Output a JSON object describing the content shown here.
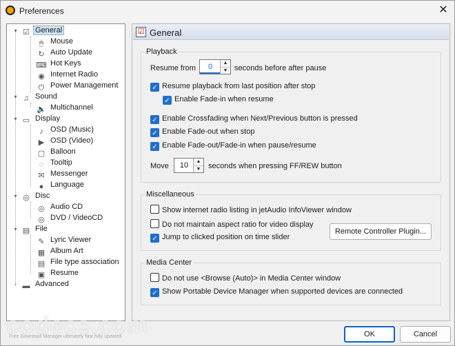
{
  "window": {
    "title": "Preferences"
  },
  "tree": {
    "items": [
      {
        "label": "General",
        "icon": "general-icon"
      },
      {
        "label": "Mouse",
        "icon": "mouse-icon"
      },
      {
        "label": "Auto Update",
        "icon": "update-icon"
      },
      {
        "label": "Hot Keys",
        "icon": "keyboard-icon"
      },
      {
        "label": "Internet Radio",
        "icon": "radio-icon"
      },
      {
        "label": "Power Management",
        "icon": "power-icon"
      },
      {
        "label": "Sound",
        "icon": "sound-icon"
      },
      {
        "label": "Multichannel",
        "icon": "speaker-icon"
      },
      {
        "label": "Display",
        "icon": "display-icon"
      },
      {
        "label": "OSD (Music)",
        "icon": "osd-music-icon"
      },
      {
        "label": "OSD (Video)",
        "icon": "osd-video-icon"
      },
      {
        "label": "Balloon",
        "icon": "balloon-icon"
      },
      {
        "label": "Tooltip",
        "icon": "tooltip-icon"
      },
      {
        "label": "Messenger",
        "icon": "messenger-icon"
      },
      {
        "label": "Language",
        "icon": "language-icon"
      },
      {
        "label": "Disc",
        "icon": "disc-icon"
      },
      {
        "label": "Audio CD",
        "icon": "cd-icon"
      },
      {
        "label": "DVD / VideoCD",
        "icon": "dvd-icon"
      },
      {
        "label": "File",
        "icon": "file-icon"
      },
      {
        "label": "Lyric Viewer",
        "icon": "lyric-icon"
      },
      {
        "label": "Album Art",
        "icon": "album-art-icon"
      },
      {
        "label": "File type association",
        "icon": "association-icon"
      },
      {
        "label": "Resume",
        "icon": "resume-icon"
      },
      {
        "label": "Advanced",
        "icon": "advanced-icon"
      }
    ]
  },
  "panel": {
    "title": "General",
    "playback": {
      "title": "Playback",
      "resume_from": "Resume from",
      "resume_value": "0",
      "resume_suffix": "seconds before after pause",
      "resume_playback": "Resume playback from last position after stop",
      "fade_in_resume": "Enable Fade-in when resume",
      "crossfading": "Enable Crossfading when Next/Previous button is pressed",
      "fade_out_stop": "Enable Fade-out when stop",
      "fade_pause": "Enable Fade-out/Fade-in when pause/resume",
      "move_label": "Move",
      "move_value": "10",
      "move_suffix": "seconds when pressing FF/REW button"
    },
    "misc": {
      "title": "Miscellaneous",
      "radio_listing": "Show internet radio listing in jetAudio InfoViewer window",
      "aspect_ratio": "Do not maintain aspect ratio for video display",
      "jump_position": "Jump to clicked position on time slider",
      "remote_button": "Remote Controller Plugin..."
    },
    "media_center": {
      "title": "Media Center",
      "browse_auto": "Do not use <Browse (Auto)> in Media Center window",
      "portable_manager": "Show Portable Device Manager when supported devices are connected"
    }
  },
  "buttons": {
    "ok": "OK",
    "cancel": "Cancel"
  },
  "watermark": {
    "text": "codecs.com",
    "sub": "Free Download Manager ultimately fast fully updated"
  }
}
